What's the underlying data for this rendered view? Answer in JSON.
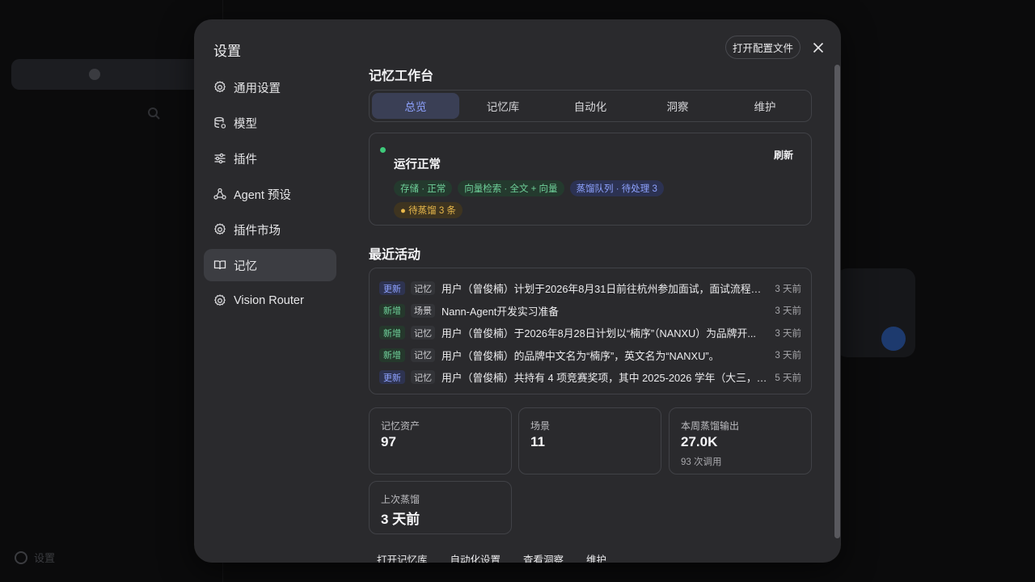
{
  "background": {
    "settings_label": "设置"
  },
  "modal": {
    "title": "设置",
    "open_config_label": "打开配置文件",
    "nav": [
      {
        "label": "通用设置",
        "icon": "gear-icon"
      },
      {
        "label": "模型",
        "icon": "database-icon"
      },
      {
        "label": "插件",
        "icon": "sliders-icon"
      },
      {
        "label": "Agent 预设",
        "icon": "agent-icon"
      },
      {
        "label": "插件市场",
        "icon": "gear-icon"
      },
      {
        "label": "记忆",
        "icon": "book-icon",
        "active": true
      },
      {
        "label": "Vision Router",
        "icon": "gear-icon"
      }
    ]
  },
  "workbench": {
    "title": "记忆工作台",
    "tabs": [
      "总览",
      "记忆库",
      "自动化",
      "洞察",
      "维护"
    ],
    "active_tab": "总览",
    "status": {
      "title": "运行正常",
      "refresh_label": "刷新",
      "chips": [
        {
          "text": "存储 · 正常",
          "color": "green"
        },
        {
          "text": "向量检索 · 全文 + 向量",
          "color": "green"
        },
        {
          "text": "蒸馏队列 · 待处理 3",
          "color": "blue"
        },
        {
          "text": "● 待蒸馏 3 条",
          "color": "yellow"
        }
      ]
    },
    "recent_title": "最近活动",
    "activities": [
      {
        "badge": "更新",
        "kind": "upd",
        "type": "记忆",
        "text": "用户（曾俊楠）计划于2026年8月31日前往杭州参加面试，面试流程为...",
        "time": "3 天前"
      },
      {
        "badge": "新增",
        "kind": "new",
        "type": "场景",
        "text": "Nann-Agent开发实习准备",
        "time": "3 天前"
      },
      {
        "badge": "新增",
        "kind": "new",
        "type": "记忆",
        "text": "用户（曾俊楠）于2026年8月28日计划以“楠序”（NANXU）为品牌开...",
        "time": "3 天前"
      },
      {
        "badge": "新增",
        "kind": "new",
        "type": "记忆",
        "text": "用户（曾俊楠）的品牌中文名为“楠序”，英文名为“NANXU”。",
        "time": "3 天前"
      },
      {
        "badge": "更新",
        "kind": "upd",
        "type": "记忆",
        "text": "用户（曾俊楠）共持有 4 项竞赛奖项，其中 2025-2026 学年（大三，本...",
        "time": "5 天前"
      }
    ],
    "stats": [
      {
        "label": "记忆资产",
        "value": "97",
        "sub": ""
      },
      {
        "label": "场景",
        "value": "11",
        "sub": ""
      },
      {
        "label": "本周蒸馏输出",
        "value": "27.0K",
        "sub": "93 次调用"
      },
      {
        "label": "上次蒸馏",
        "value": "3 天前",
        "sub": ""
      }
    ],
    "bottom_links": [
      "打开记忆库",
      "自动化设置",
      "查看洞察",
      "维护"
    ]
  }
}
